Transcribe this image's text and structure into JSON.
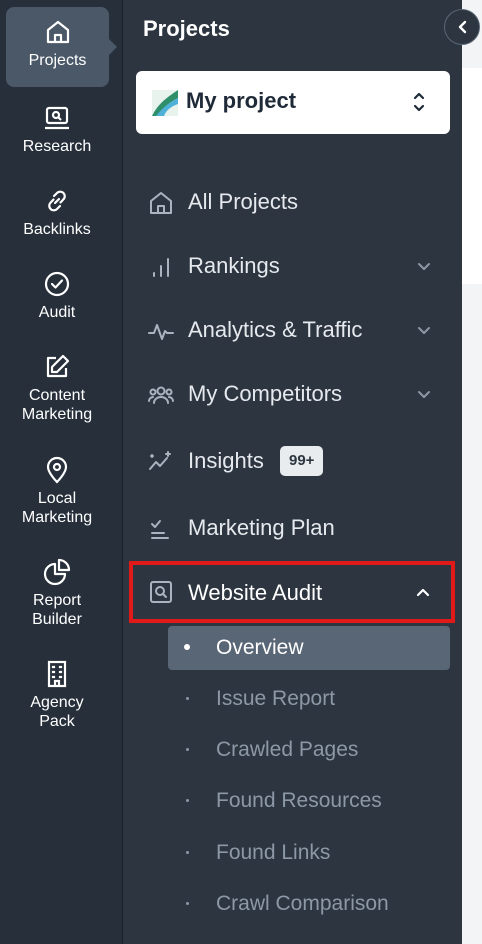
{
  "rail": {
    "items": [
      {
        "label": "Projects",
        "icon": "home-icon"
      },
      {
        "label": "Research",
        "icon": "laptop-search-icon"
      },
      {
        "label": "Backlinks",
        "icon": "link-icon"
      },
      {
        "label": "Audit",
        "icon": "check-circle-icon"
      },
      {
        "label": "Content\nMarketing",
        "icon": "edit-icon"
      },
      {
        "label": "Local\nMarketing",
        "icon": "map-pin-icon"
      },
      {
        "label": "Report\nBuilder",
        "icon": "pie-chart-icon"
      },
      {
        "label": "Agency\nPack",
        "icon": "building-icon"
      }
    ]
  },
  "panel": {
    "title": "Projects",
    "project_select": {
      "value": "My project"
    },
    "nav": [
      {
        "label": "All Projects",
        "icon": "home-icon"
      },
      {
        "label": "Rankings",
        "icon": "bar-chart-icon"
      },
      {
        "label": "Analytics & Traffic",
        "icon": "pulse-icon"
      },
      {
        "label": "My Competitors",
        "icon": "users-icon"
      },
      {
        "label": "Insights",
        "icon": "sparkle-chart-icon",
        "badge": "99+"
      },
      {
        "label": "Marketing Plan",
        "icon": "checklist-icon"
      },
      {
        "label": "Website Audit",
        "icon": "search-box-icon"
      }
    ],
    "audit_sub": [
      {
        "label": "Overview"
      },
      {
        "label": "Issue Report"
      },
      {
        "label": "Crawled Pages"
      },
      {
        "label": "Found Resources"
      },
      {
        "label": "Found Links"
      },
      {
        "label": "Crawl Comparison"
      }
    ]
  },
  "colors": {
    "rail_bg": "#262f3a",
    "panel_bg": "#2d3640",
    "active_bg": "#4a5868",
    "highlight_border": "#e01919"
  }
}
